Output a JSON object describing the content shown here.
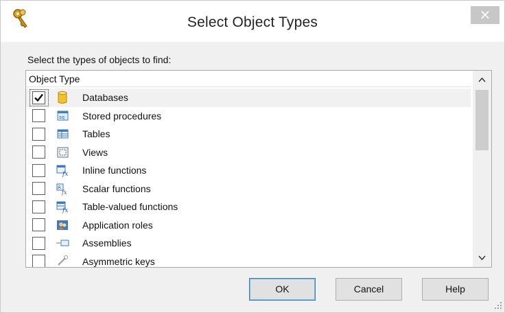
{
  "window": {
    "title": "Select Object Types",
    "close_label": "×",
    "icon": "keys-icon"
  },
  "prompt": "Select the types of objects to find:",
  "list": {
    "header": "Object Type",
    "items": [
      {
        "label": "Databases",
        "checked": true,
        "icon": "database-icon"
      },
      {
        "label": "Stored procedures",
        "checked": false,
        "icon": "stored-procedure-icon"
      },
      {
        "label": "Tables",
        "checked": false,
        "icon": "table-icon"
      },
      {
        "label": "Views",
        "checked": false,
        "icon": "view-icon"
      },
      {
        "label": "Inline functions",
        "checked": false,
        "icon": "inline-function-icon"
      },
      {
        "label": "Scalar functions",
        "checked": false,
        "icon": "scalar-function-icon"
      },
      {
        "label": "Table-valued functions",
        "checked": false,
        "icon": "table-valued-function-icon"
      },
      {
        "label": "Application roles",
        "checked": false,
        "icon": "application-role-icon"
      },
      {
        "label": "Assemblies",
        "checked": false,
        "icon": "assembly-icon"
      },
      {
        "label": "Asymmetric keys",
        "checked": false,
        "icon": "asymmetric-key-icon"
      }
    ],
    "scroll_up": "^",
    "scroll_down": "v"
  },
  "buttons": {
    "ok": "OK",
    "cancel": "Cancel",
    "help": "Help"
  },
  "colors": {
    "selected_row": "#f1f1f1",
    "default_button_border": "#3c7fb1",
    "close_button": "#c7c7c7"
  }
}
